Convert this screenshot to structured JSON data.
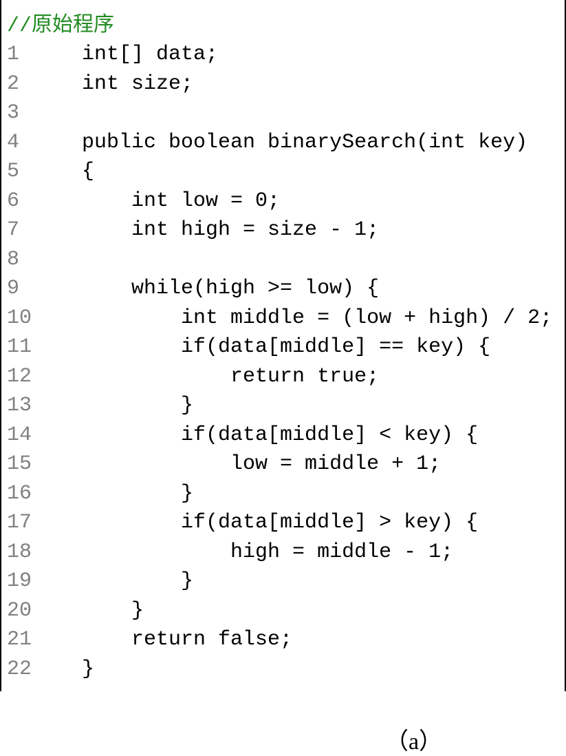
{
  "comment": "//原始程序",
  "lines": [
    {
      "num": "1",
      "indent": "   ",
      "code": "int[] data;"
    },
    {
      "num": "2",
      "indent": "   ",
      "code": "int size;"
    },
    {
      "num": "3",
      "indent": "",
      "code": ""
    },
    {
      "num": "4",
      "indent": "   ",
      "code": "public boolean binarySearch(int key)"
    },
    {
      "num": "5",
      "indent": "   ",
      "code": "{"
    },
    {
      "num": "6",
      "indent": "       ",
      "code": "int low = 0;"
    },
    {
      "num": "7",
      "indent": "       ",
      "code": "int high = size - 1;"
    },
    {
      "num": "8",
      "indent": "",
      "code": ""
    },
    {
      "num": "9",
      "indent": "       ",
      "code": "while(high >= low) {"
    },
    {
      "num": "10",
      "indent": "           ",
      "code": "int middle = (low + high) / 2;"
    },
    {
      "num": "11",
      "indent": "           ",
      "code": "if(data[middle] == key) {"
    },
    {
      "num": "12",
      "indent": "               ",
      "code": "return true;"
    },
    {
      "num": "13",
      "indent": "           ",
      "code": "}"
    },
    {
      "num": "14",
      "indent": "           ",
      "code": "if(data[middle] < key) {"
    },
    {
      "num": "15",
      "indent": "               ",
      "code": "low = middle + 1;"
    },
    {
      "num": "16",
      "indent": "           ",
      "code": "}"
    },
    {
      "num": "17",
      "indent": "           ",
      "code": "if(data[middle] > key) {"
    },
    {
      "num": "18",
      "indent": "               ",
      "code": "high = middle - 1;"
    },
    {
      "num": "19",
      "indent": "           ",
      "code": "}"
    },
    {
      "num": "20",
      "indent": "       ",
      "code": "}"
    },
    {
      "num": "21",
      "indent": "       ",
      "code": "return false;"
    },
    {
      "num": "22",
      "indent": "   ",
      "code": "}"
    }
  ],
  "figure_label": "（a）"
}
